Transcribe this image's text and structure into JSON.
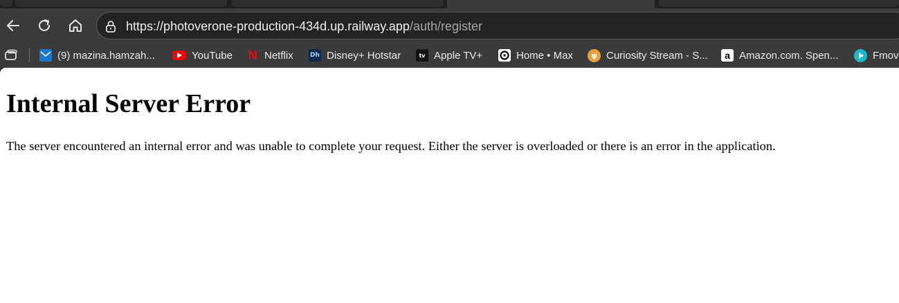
{
  "browser": {
    "address_bar": {
      "url_domain": "https://photoverone-production-434d.up.railway.app",
      "url_path": "/auth/register"
    },
    "bookmarks": [
      {
        "label": "(9) mazina.hamzah...",
        "icon": "mail-icon"
      },
      {
        "label": "YouTube",
        "icon": "youtube-icon"
      },
      {
        "label": "Netflix",
        "icon": "netflix-icon"
      },
      {
        "label": "Disney+ Hotstar",
        "icon": "disney-hotstar-icon"
      },
      {
        "label": "Apple TV+",
        "icon": "apple-tv-icon"
      },
      {
        "label": "Home • Max",
        "icon": "max-icon"
      },
      {
        "label": "Curiosity Stream - S...",
        "icon": "curiosity-stream-icon"
      },
      {
        "label": "Amazon.com. Spen...",
        "icon": "amazon-icon"
      },
      {
        "label": "Fmov",
        "icon": "fmovies-icon"
      }
    ],
    "colors": {
      "chrome": "#3b3b3b",
      "address_bg": "#232323",
      "page_bg": "#ffffff"
    }
  },
  "page": {
    "heading": "Internal Server Error",
    "message": "The server encountered an internal error and was unable to complete your request. Either the server is overloaded or there is an error in the application."
  }
}
